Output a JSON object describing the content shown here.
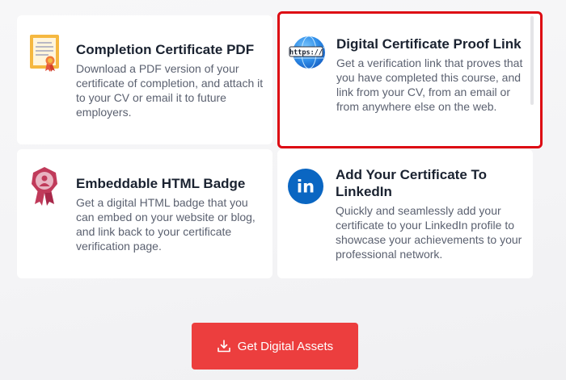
{
  "colors": {
    "accent_red": "#ec3e3e",
    "highlight_border": "#dd0a13",
    "title_text": "#1a2230",
    "body_text": "#5b6170",
    "linkedin_blue": "#0a66c2"
  },
  "cards": [
    {
      "icon": "certificate-document-icon",
      "title": "Completion Certificate PDF",
      "description": "Download a PDF version of your certificate of completion, and attach it to your CV or email it to future employers."
    },
    {
      "icon": "globe-https-icon",
      "icon_text": "https://",
      "title": "Digital Certificate Proof Link",
      "description": "Get a verification link that proves that you have completed this course, and link from your CV, from an email or from anywhere else on the web."
    },
    {
      "icon": "badge-ribbon-icon",
      "title": "Embeddable HTML Badge",
      "description": "Get a digital HTML badge that you can embed on your website or blog, and link back to your certificate verification page."
    },
    {
      "icon": "linkedin-icon",
      "icon_text": "in",
      "title": "Add Your Certificate To LinkedIn",
      "description": "Quickly and seamlessly add your certificate to your LinkedIn profile to showcase your achievements to your professional network."
    }
  ],
  "action_button": {
    "icon": "download-icon",
    "label": "Get Digital Assets"
  }
}
